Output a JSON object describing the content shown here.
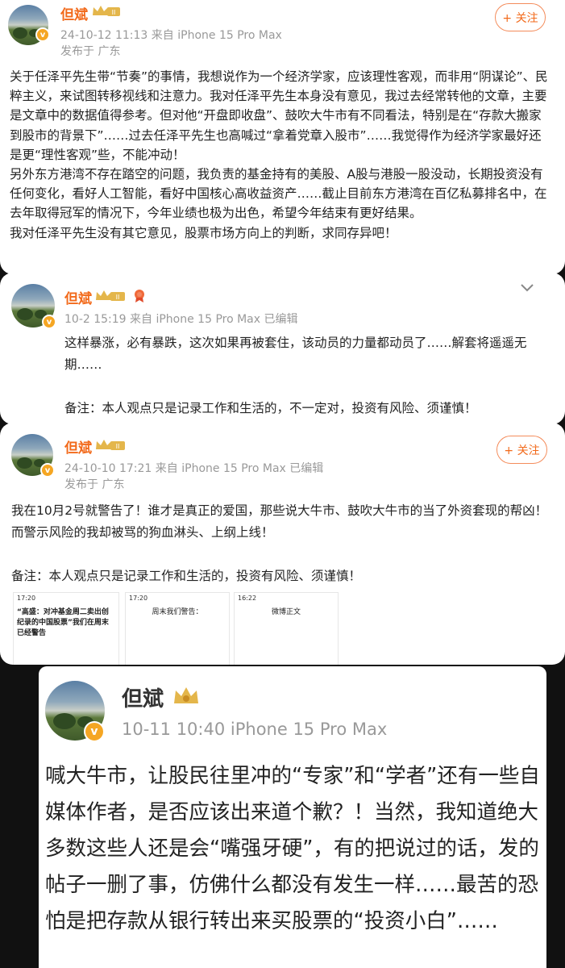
{
  "posts": [
    {
      "author": "但斌",
      "meta_line1": "24-10-12 11:13  来自 iPhone 15 Pro Max",
      "meta_line2": "发布于 广东",
      "follow_label": "+ 关注",
      "paragraphs": [
        "关于任泽平先生带“节奏”的事情，我想说作为一个经济学家，应该理性客观，而非用“阴谋论”、民粹主义，来试图转移视线和注意力。我对任泽平先生本身没有意见，我过去经常转他的文章，主要是文章中的数据值得参考。但对他“开盘即收盘”、鼓吹大牛市有不同看法，特别是在“存款大搬家到股市的背景下”……过去任泽平先生也高喊过“拿着党章入股市”……我觉得作为经济学家最好还是更“理性客观”些，不能冲动！",
        "另外东方港湾不存在踏空的问题，我负责的基金持有的美股、A股与港股一股没动，长期投资没有任何变化，看好人工智能，看好中国核心高收益资产……截止目前东方港湾在百亿私募排名中，在去年取得冠军的情况下，今年业绩也极为出色，希望今年结束有更好结果。",
        "我对任泽平先生没有其它意见，股票市场方向上的判断，求同存异吧！"
      ]
    },
    {
      "author": "但斌",
      "meta_line1": "10-2 15:19 来自 iPhone 15 Pro Max 已编辑",
      "paragraphs": [
        "这样暴涨，必有暴跌，这次如果再被套住，该动员的力量都动员了……解套将遥遥无期……",
        "",
        "备注：本人观点只是记录工作和生活的，不一定对，投资有风险、须谨慎！"
      ]
    },
    {
      "author": "但斌",
      "meta_line1": "24-10-10 17:21  来自 iPhone 15 Pro Max 已编辑",
      "meta_line2": "发布于 广东",
      "follow_label": "+ 关注",
      "paragraphs": [
        "我在10月2号就警告了！谁才是真正的爱国，那些说大牛市、鼓吹大牛市的当了外资套现的帮凶！而警示风险的我却被骂的狗血淋头、上纲上线！",
        "",
        "备注：本人观点只是记录工作和生活的，投资有风险、须谨慎！"
      ],
      "thumbs": [
        {
          "time": "17:20",
          "text": "“高盛：对冲基金周二卖出创纪录的中国股票”我们在周末已经警告"
        },
        {
          "time": "17:20",
          "text": "周末我们警告："
        },
        {
          "time": "16:22",
          "text": "微博正文"
        }
      ]
    },
    {
      "author": "但斌",
      "meta_line1": "10-11 10:40   iPhone 15 Pro Max",
      "paragraphs": [
        "喊大牛市，让股民往里冲的“专家”和“学者”还有一些自媒体作者，是否应该出来道个歉？！当然，我知道绝大多数这些人还是会“嘴强牙硬”，有的把说过的话，发的帖子一删了事，仿佛什么都没有发生一样……最苦的恐怕是把存款从银行转出来买股票的“投资小白”……"
      ]
    }
  ]
}
